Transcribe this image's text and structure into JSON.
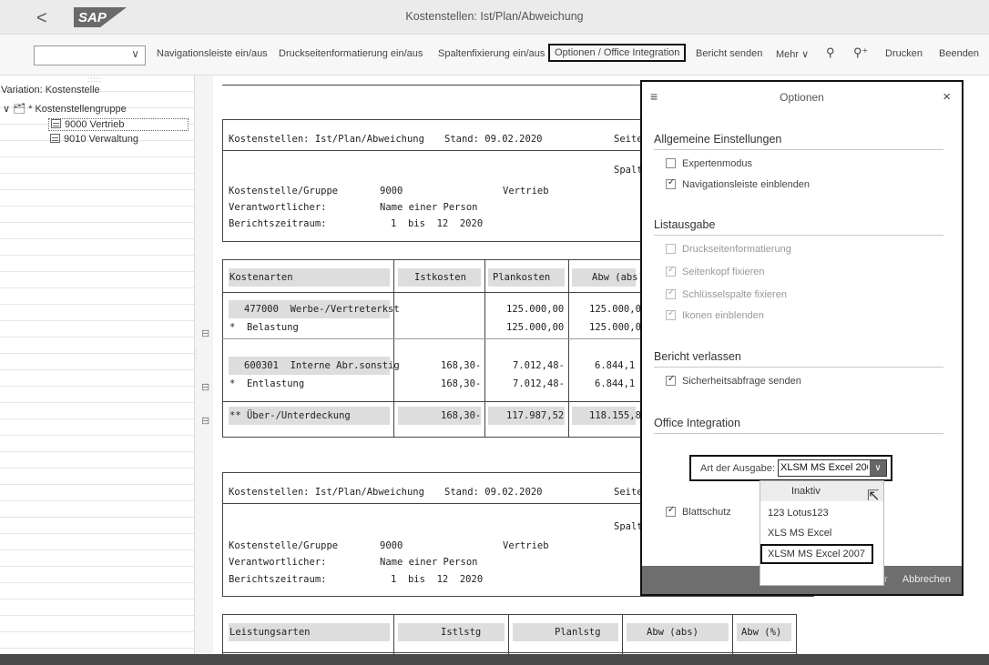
{
  "titlebar": {
    "back": "<",
    "logo": "SAP",
    "title": "Kostenstellen: Ist/Plan/Abweichung"
  },
  "toolbar": {
    "variant_value": "",
    "nav": "Navigationsleiste ein/aus",
    "print_format": "Druckseitenformatierung ein/aus",
    "fix_columns": "Spaltenfixierung ein/aus",
    "options": "Optionen / Office Integration",
    "send": "Bericht senden",
    "more": "Mehr ∨",
    "search": "⚲",
    "search_next": "⚲⁺",
    "print": "Drucken",
    "exit": "Beenden"
  },
  "tree": {
    "splitter": ":::::",
    "variation": "Variation: Kostenstelle",
    "group": "∨ 🗂 * Kostenstellengruppe",
    "items": [
      "9000 Vertrieb",
      "9010 Verwaltung"
    ]
  },
  "report": {
    "section1": {
      "title": "Kostenstellen: Ist/Plan/Abweichung",
      "stand": "Stand: 09.02.2020",
      "seite": "Seite",
      "spalt": "Spalt",
      "label_group": "Kostenstelle/Gruppe",
      "val_group": "9000",
      "val_group_name": "Vertrieb",
      "label_resp": "Verantwortlicher:",
      "val_resp": "Name einer Person",
      "label_period": "Berichtszeitraum:",
      "val_period": "1  bis  12  2020"
    },
    "table1": {
      "headers": [
        "Kostenarten",
        "Istkosten",
        "Plankosten",
        "Abw (abs)"
      ],
      "rows": [
        [
          "477000  Werbe-/Vertreterkst",
          "",
          "125.000,00",
          "125.000,0"
        ],
        [
          "*  Belastung",
          "",
          "125.000,00",
          "125.000,0"
        ],
        [
          "600301  Interne Abr.sonstig",
          "168,30-",
          "7.012,48-",
          "6.844,1"
        ],
        [
          "*  Entlastung",
          "168,30-",
          "7.012,48-",
          "6.844,1"
        ],
        [
          "** Über-/Unterdeckung",
          "168,30-",
          "117.987,52",
          "118.155,8"
        ]
      ]
    },
    "section2": {
      "title": "Kostenstellen: Ist/Plan/Abweichung",
      "stand": "Stand: 09.02.2020",
      "seite": "Seite",
      "spalt": "Spalt",
      "label_group": "Kostenstelle/Gruppe",
      "val_group": "9000",
      "val_group_name": "Vertrieb",
      "label_resp": "Verantwortlicher:",
      "val_resp": "Name einer Person",
      "label_period": "Berichtszeitraum:",
      "val_period": "1  bis  12  2020"
    },
    "table2": {
      "headers": [
        "Leistungsarten",
        "Istlstg",
        "Planlstg",
        "Abw (abs)",
        "Abw (%)"
      ]
    }
  },
  "options": {
    "menu": "≡",
    "title": "Optionen",
    "close": "×",
    "sec_general": "Allgemeine Einstellungen",
    "expert": "Expertenmodus",
    "navbar": "Navigationsleiste einblenden",
    "sec_list": "Listausgabe",
    "print_format": "Druckseitenformatierung",
    "header_fix": "Seitenkopf fixieren",
    "key_fix": "Schlüsselspalte fixieren",
    "icons": "Ikonen einblenden",
    "sec_leave": "Bericht verlassen",
    "safety": "Sicherheitsabfrage senden",
    "sec_office": "Office Integration",
    "output_label": "Art der Ausgabe:",
    "output_value": "XLSM MS Excel 200...",
    "sheet_protect": "Blattschutz",
    "cancel": "Abbrechen",
    "footer_sep": "r"
  },
  "dropdown": {
    "items": [
      "Inaktiv",
      "123   Lotus123",
      "XLS   MS Excel",
      "XLSM MS Excel 2007"
    ]
  }
}
